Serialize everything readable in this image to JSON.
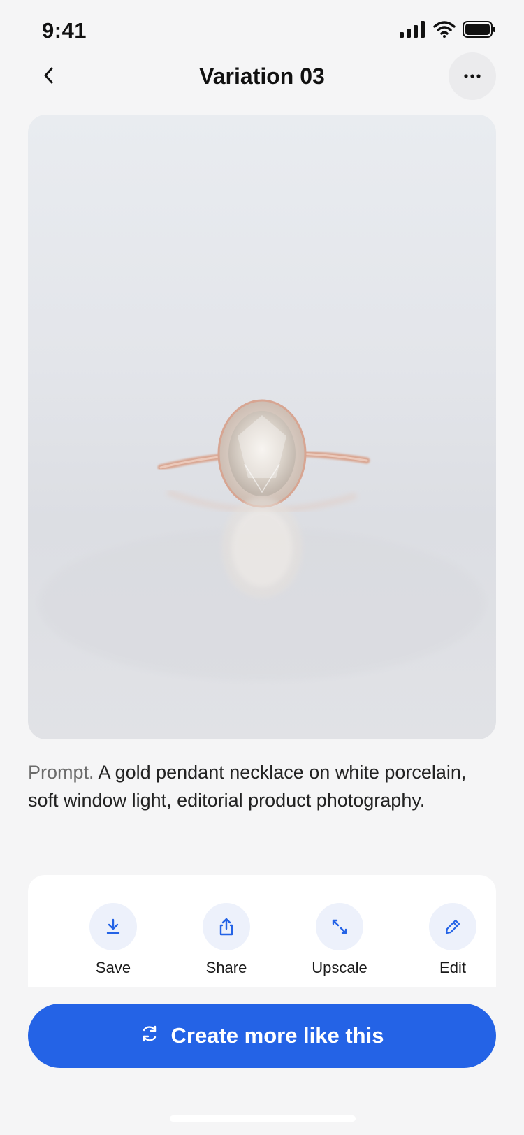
{
  "status_bar": {
    "time": "9:41"
  },
  "nav": {
    "title": "Variation 03",
    "back_icon": "chevron-left-icon",
    "more_icon": "ellipsis-icon"
  },
  "prompt": {
    "label": "Prompt.",
    "text": "A gold pendant necklace on white porcelain, soft window light, editorial product photography."
  },
  "actions": [
    {
      "label": "Save",
      "icon": "download-icon"
    },
    {
      "label": "Share",
      "icon": "share-icon"
    },
    {
      "label": "Upscale",
      "icon": "expand-icon"
    },
    {
      "label": "Edit",
      "icon": "pencil-icon"
    }
  ],
  "cta": {
    "label": "Create more like this",
    "icon": "refresh-icon"
  },
  "colors": {
    "accent": "#2463e6",
    "action_bg": "#edf1fb",
    "background": "#f5f5f6"
  }
}
